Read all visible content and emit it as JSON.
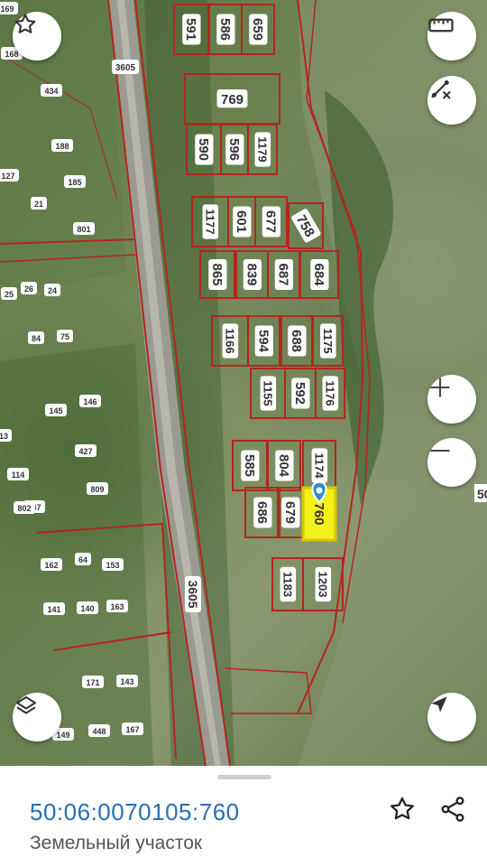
{
  "map": {
    "road_label": "3605",
    "road_label_rotated": "3605",
    "edge_label": "50",
    "plots": [
      {
        "label": "591"
      },
      {
        "label": "586"
      },
      {
        "label": "659"
      },
      {
        "label": "769"
      },
      {
        "label": "590"
      },
      {
        "label": "596"
      },
      {
        "label": "1179"
      },
      {
        "label": "1177"
      },
      {
        "label": "601"
      },
      {
        "label": "677"
      },
      {
        "label": "758"
      },
      {
        "label": "865"
      },
      {
        "label": "839"
      },
      {
        "label": "687"
      },
      {
        "label": "684"
      },
      {
        "label": "1166"
      },
      {
        "label": "594"
      },
      {
        "label": "688"
      },
      {
        "label": "1175"
      },
      {
        "label": "1155"
      },
      {
        "label": "592"
      },
      {
        "label": "1176"
      },
      {
        "label": "585"
      },
      {
        "label": "804"
      },
      {
        "label": "1174"
      },
      {
        "label": "686"
      },
      {
        "label": "679"
      },
      {
        "label": "760"
      },
      {
        "label": "1183"
      },
      {
        "label": "1203"
      }
    ],
    "small_labels": [
      "169",
      "168",
      "434",
      "188",
      "127",
      "185",
      "21",
      "801",
      "25",
      "26",
      "24",
      "75",
      "84",
      "146",
      "145",
      "13",
      "427",
      "114",
      "809",
      "147",
      "162",
      "64",
      "153",
      "141",
      "140",
      "163",
      "143",
      "171",
      "149",
      "448",
      "167",
      "802"
    ],
    "selected_plot": "760"
  },
  "controls": {
    "favorite_icon": "star-outline-icon",
    "ruler_icon": "ruler-icon",
    "measure_icon": "measure-area-icon",
    "zoom_in_icon": "plus-icon",
    "zoom_out_icon": "minus-icon",
    "layers_icon": "layers-icon",
    "locate_icon": "navigation-arrow-icon"
  },
  "sheet": {
    "cadastral_number": "50:06:0070105:760",
    "property_type": "Земельный участок",
    "favorite_icon": "star-outline-icon",
    "share_icon": "share-icon"
  },
  "colors": {
    "accent": "#2a6fb0",
    "boundary": "#b3261e",
    "selected_fill": "#f3f01a"
  }
}
